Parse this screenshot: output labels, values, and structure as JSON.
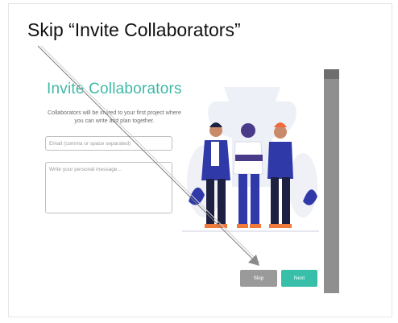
{
  "caption": "Skip “Invite Collaborators”",
  "dialog": {
    "title": "Invite Collaborators",
    "description": "Collaborators will be invited to your first project where you can write and plan together.",
    "email_placeholder": "Email (comma or space separated)",
    "message_placeholder": "Write your personal message...",
    "skip_label": "Skip",
    "next_label": "Next"
  },
  "colors": {
    "accent": "#3fb8a6",
    "next_button": "#38bfa9",
    "skip_button": "#9a9a9a",
    "scrollbar": "#8f8f8f"
  },
  "icons": [
    "team-illustration",
    "pointer-arrow"
  ]
}
